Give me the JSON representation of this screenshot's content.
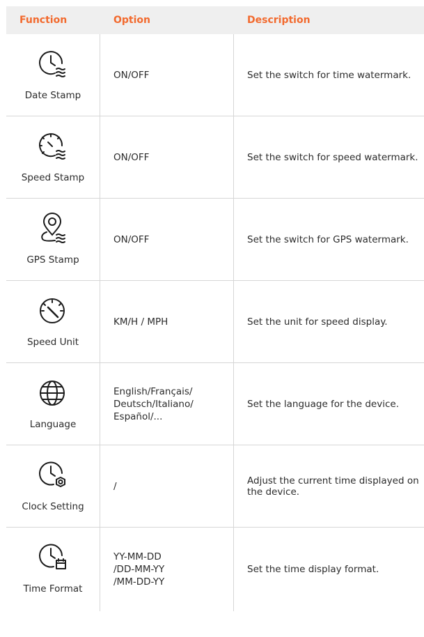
{
  "header": {
    "function": "Function",
    "option": "Option",
    "description": "Description"
  },
  "colors": {
    "accent": "#f26a2e",
    "header_bg": "#efefef",
    "border": "#d6d6d6"
  },
  "rows": [
    {
      "icon": "clock-waves-icon",
      "function": "Date Stamp",
      "option": "ON/OFF",
      "description": "Set the switch for time watermark."
    },
    {
      "icon": "speedometer-waves-icon",
      "function": "Speed Stamp",
      "option": "ON/OFF",
      "description": "Set the switch for speed watermark."
    },
    {
      "icon": "location-pin-waves-icon",
      "function": "GPS Stamp",
      "option": "ON/OFF",
      "description": "Set the switch for GPS watermark."
    },
    {
      "icon": "speedometer-icon",
      "function": "Speed Unit",
      "option": "KM/H / MPH",
      "description": "Set the unit for speed display."
    },
    {
      "icon": "globe-icon",
      "function": "Language",
      "option": "English/Français/\nDeutsch/Italiano/\nEspañol/...",
      "description": "Set the language for the device."
    },
    {
      "icon": "clock-gear-icon",
      "function": "Clock Setting",
      "option": "/",
      "description": "Adjust the current time displayed on the device."
    },
    {
      "icon": "clock-calendar-icon",
      "function": "Time Format",
      "option": "YY-MM-DD\n/DD-MM-YY\n/MM-DD-YY",
      "description": "Set the time display format."
    }
  ]
}
